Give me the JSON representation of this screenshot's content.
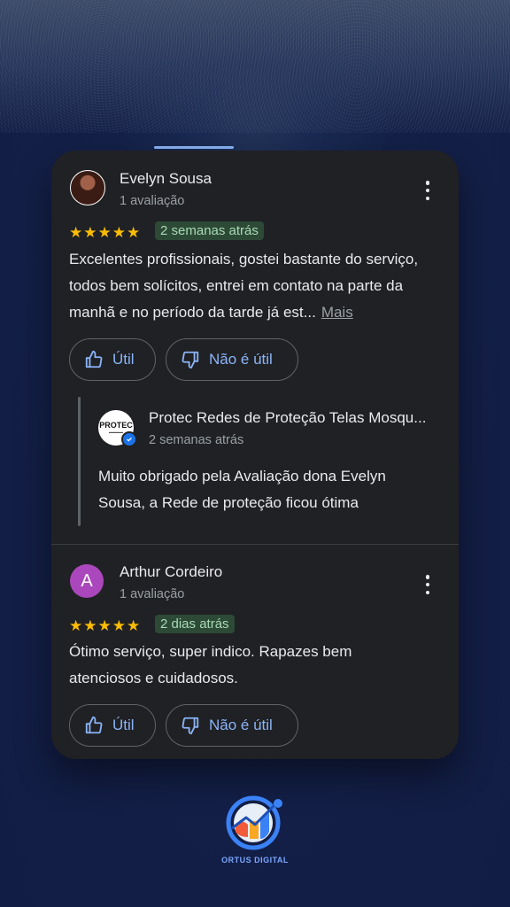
{
  "reviews": [
    {
      "author": "Evelyn Sousa",
      "meta": "1 avaliação",
      "rating": 5,
      "date": "2 semanas atrás",
      "text": "Excelentes profissionais, gostei bastante do serviço, todos bem solícitos, entrei em contato na parte da manhã e no período da tarde já est...",
      "more_label": "Mais",
      "helpful_label": "Útil",
      "not_helpful_label": "Não é útil",
      "reply": {
        "owner_name": "Protec Redes de Proteção Telas Mosqu...",
        "owner_logo_text": "PROTEC",
        "date": "2 semanas atrás",
        "text": "Muito obrigado pela Avaliação dona Evelyn Sousa, a Rede de proteção ficou ótima"
      }
    },
    {
      "author": "Arthur Cordeiro",
      "avatar_letter": "A",
      "meta": "1 avaliação",
      "rating": 5,
      "date": "2 dias atrás",
      "text": "Ótimo serviço, super indico. Rapazes bem atenciosos e cuidadosos.",
      "helpful_label": "Útil",
      "not_helpful_label": "Não é útil"
    }
  ],
  "footer": {
    "brand": "ORTUS DIGITAL"
  },
  "colors": {
    "card_bg": "#202124",
    "accent": "#8ab4f8",
    "star": "#fbbc04",
    "badge_bg": "#2d4a36",
    "badge_text": "#a8dab5",
    "avatar_arthur": "#ab47bc"
  }
}
